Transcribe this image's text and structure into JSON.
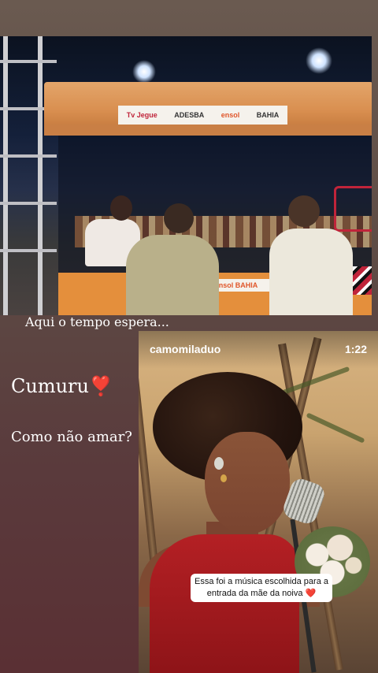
{
  "story": {
    "caption_top": "Aqui o tempo espera...",
    "title": "Cumuru",
    "title_emoji": "❣️",
    "subtitle": "Como não amar?"
  },
  "photo": {
    "sponsors": [
      "Tv Jegue",
      "ADESBA",
      "ensol",
      "BAHIA"
    ],
    "counter_banner": "ensol  BAHIA"
  },
  "video": {
    "username": "camomiladuo",
    "time": "1:22",
    "caption_line1": "Essa foi a música escolhida para a",
    "caption_line2": "entrada da mãe da noiva",
    "caption_emoji": "❤️"
  },
  "colors": {
    "background_top": "#6a5a50",
    "background_bottom": "#5a3034",
    "heart": "#e0263a",
    "canopy": "#d98f50"
  }
}
